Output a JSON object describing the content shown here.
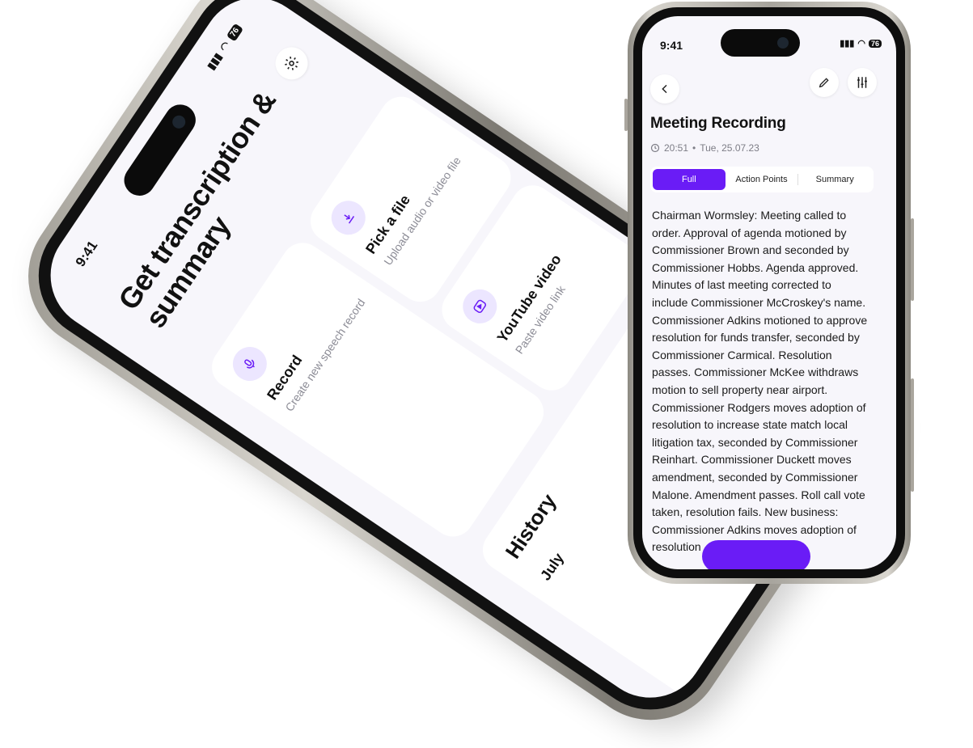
{
  "left_phone": {
    "status_time": "9:41",
    "battery": "76",
    "title": "Get transcription & summary",
    "settings_icon": "gear-icon",
    "cards": {
      "record": {
        "title": "Record",
        "subtitle": "Create new speech record",
        "icon": "microphone-icon"
      },
      "pick": {
        "title": "Pick a file",
        "subtitle": "Upload audio or video file",
        "icon": "download-icon"
      },
      "youtube": {
        "title": "YouTube video",
        "subtitle": "Paste video link",
        "icon": "play-icon"
      }
    },
    "history_title": "History",
    "history_month": "July"
  },
  "right_phone": {
    "status_time": "9:41",
    "battery": "76",
    "title": "Meeting Recording",
    "meta_time": "20:51",
    "meta_sep": "•",
    "meta_date": "Tue, 25.07.23",
    "tabs": [
      "Full",
      "Action Points",
      "Summary"
    ],
    "active_tab": "Full",
    "transcript": "Chairman Wormsley: Meeting called to order. Approval of agenda motioned by Commissioner Brown and seconded by Commissioner Hobbs. Agenda approved. Minutes of last meeting corrected to include Commissioner McCroskey's name. Commissioner Adkins motioned to approve resolution for funds transfer, seconded by Commissioner Carmical. Resolution passes. Commissioner McKee withdraws motion to sell property near airport. Commissioner Rodgers moves adoption of resolution to increase state match local litigation tax, seconded by Commissioner Reinhart. Commissioner Duckett moves amendment, seconded by Commissioner Malone. Amendment passes. Roll call vote taken, resolution fails. New business: Commissioner Adkins moves adoption of resolution"
  },
  "colors": {
    "accent": "#6a1cf6",
    "accent_light": "#ece6ff",
    "screen_bg": "#f7f6fb"
  }
}
